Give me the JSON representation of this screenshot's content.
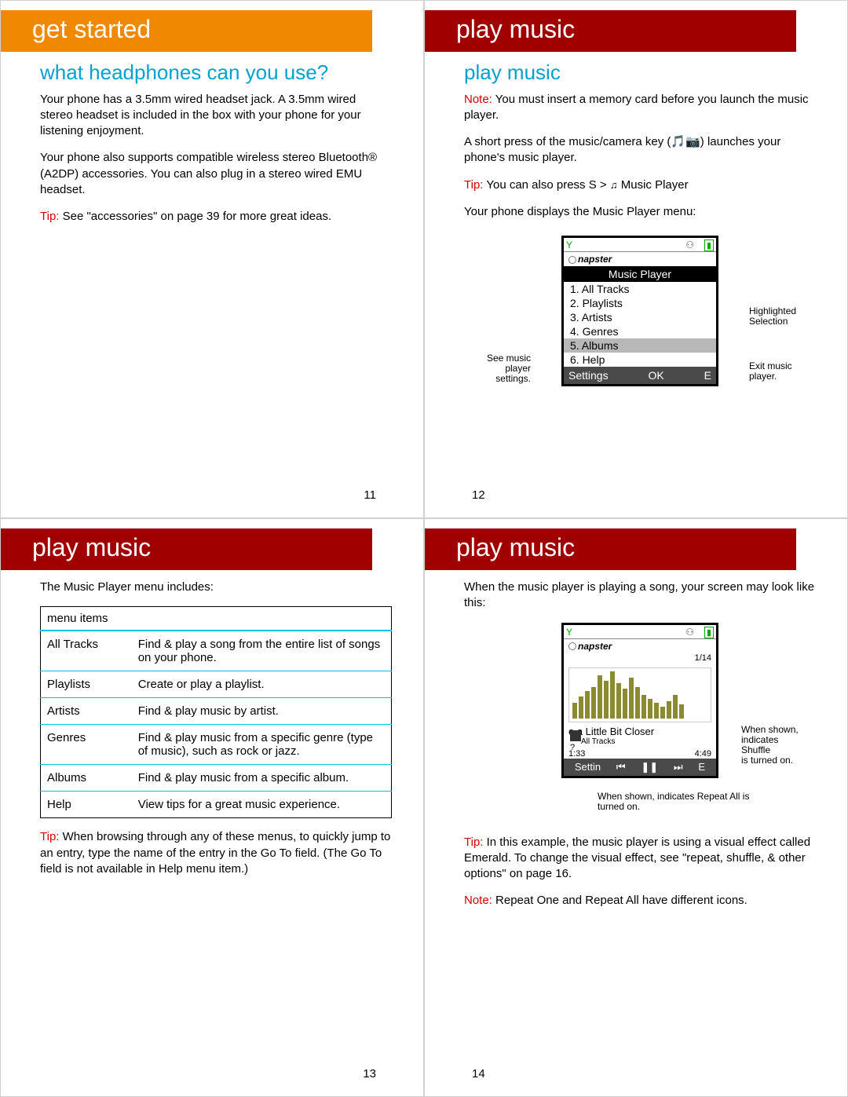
{
  "p11": {
    "banner": "get started",
    "heading": "what headphones can you use?",
    "para1": "Your phone has a 3.5mm wired headset jack. A 3.5mm wired stereo headset is included in the box with your phone for your listening enjoyment.",
    "para2": "Your phone also supports compatible wireless stereo Bluetooth® (A2DP) accessories. You can also plug in a stereo wired EMU headset.",
    "tip_label": "Tip:",
    "tip_text": " See \"accessories\" on page 39 for more great ideas.",
    "page": "11"
  },
  "p12": {
    "banner": "play music",
    "heading": "play music",
    "note_label": "Note:",
    "note_text": " You must insert a memory card before you launch the music player.",
    "para1": "A short press of the music/camera key (🎵📷) launches your phone's music player.",
    "tip_label": "Tip:",
    "tip_pre": " You can also press ",
    "tip_key": "S",
    "tip_gt": " > ",
    "tip_icon": "♫",
    "tip_item": " Music Player",
    "para2_pre": "Your phone displays the ",
    "para2_item": "Music Player",
    "para2_post": " menu:",
    "phone": {
      "brand": "napster",
      "title": "Music Player",
      "items": [
        "1.  All Tracks",
        "2.  Playlists",
        "3.  Artists",
        "4.  Genres",
        "5.  Albums",
        "6.  Help"
      ],
      "soft_left": "Settings",
      "soft_mid": "OK",
      "soft_right": "E"
    },
    "callouts": {
      "left": "See music player settings.",
      "right_top": "Highlighted Selection",
      "right_bot": "Exit music player."
    },
    "page": "12"
  },
  "p13": {
    "banner": "play music",
    "intro_pre": "The ",
    "intro_item": "Music Player",
    "intro_post": " menu includes:",
    "table_header": "menu items",
    "rows": [
      {
        "label": "All Tracks",
        "desc": "Find & play a song from the entire list of songs on your phone."
      },
      {
        "label": "Playlists",
        "desc": "Create or play a playlist."
      },
      {
        "label": "Artists",
        "desc": "Find & play music by artist."
      },
      {
        "label": "Genres",
        "desc": "Find & play music from a specific genre (type of music), such as rock or jazz."
      },
      {
        "label": "Albums",
        "desc": "Find & play music from a specific album."
      },
      {
        "label": "Help",
        "desc": "View tips for a great music experience."
      }
    ],
    "tip_label": "Tip:",
    "tip_text": " When browsing through any of these menus, to quickly jump to an entry, type the name of the entry in the Go To field. (The Go To field is not available in Help menu item.)",
    "page": "13"
  },
  "p14": {
    "banner": "play music",
    "intro": "When the music player is playing a song, your screen may look like this:",
    "np": {
      "brand": "napster",
      "count": "1/14",
      "song_pre": "e a Little Bit Cl",
      "song_post": "oser",
      "sub": "All Tracks",
      "time_l": "1:33",
      "time_r": "4:49",
      "soft": "Settin",
      "ctrl": [
        "⏮",
        "❚❚",
        "⏭"
      ],
      "vis_heights": [
        20,
        28,
        35,
        40,
        55,
        48,
        60,
        45,
        38,
        52,
        40,
        30,
        25,
        20,
        15,
        22,
        30,
        18
      ]
    },
    "callouts": {
      "right": "When shown, indicates ",
      "right_key": "Shuffle",
      "right_post": " is turned on.",
      "bottom": "When shown, indicates ",
      "bottom_key": "Repeat All",
      "bottom_post": " is turned on."
    },
    "tip_label": "Tip:",
    "tip_text": " In this example, the music player is using a visual effect called Emerald. To change the visual effect, see \"repeat, shuffle, & other options\" on page 16.",
    "note_label": "Note:",
    "note_pre": " ",
    "note_k1": "Repeat One",
    "note_mid": " and ",
    "note_k2": "Repeat All",
    "note_post": " have different icons.",
    "page": "14"
  }
}
